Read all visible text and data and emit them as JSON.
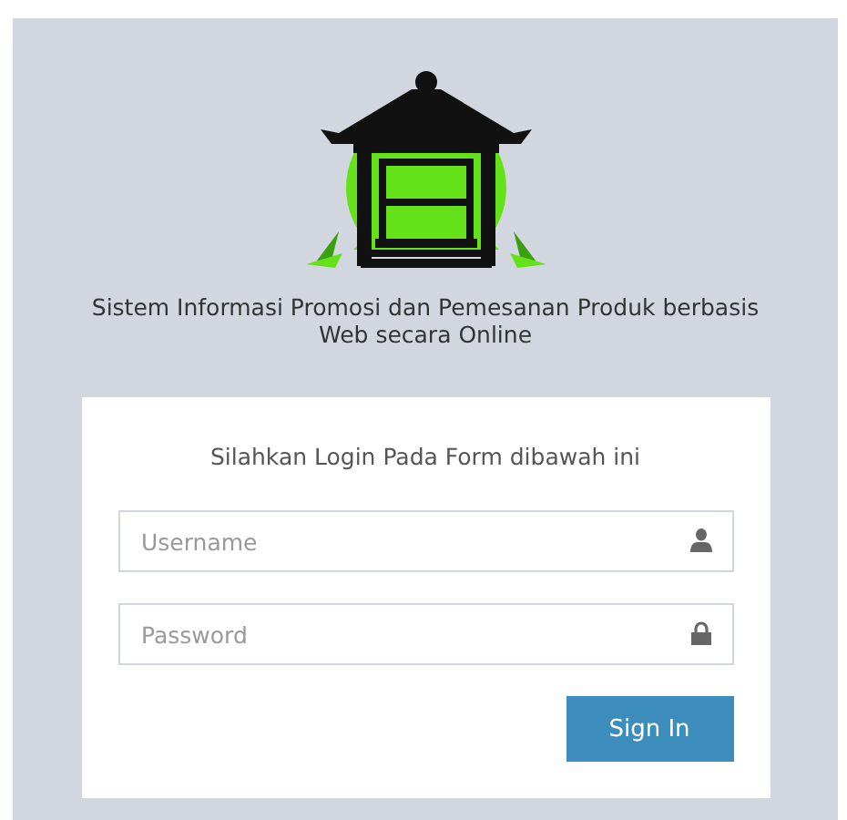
{
  "app_title": "Sistem Informasi Promosi dan Pemesanan Produk berbasis Web secara Online",
  "login_box": {
    "message": "Silahkan Login Pada Form dibawah ini",
    "fields": [
      {
        "kind": "user",
        "placeholder": "Username"
      },
      {
        "kind": "lock",
        "placeholder": "Password"
      }
    ],
    "submit_button": "Sign In"
  }
}
